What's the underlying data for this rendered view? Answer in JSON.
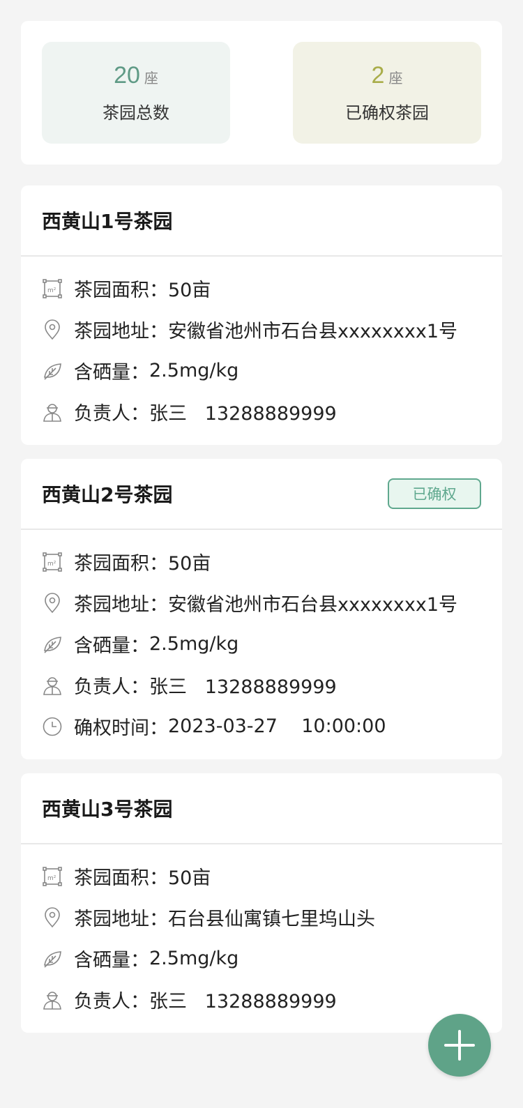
{
  "summary": {
    "total": {
      "value": "20",
      "unit": "座",
      "label": "茶园总数"
    },
    "confirmed": {
      "value": "2",
      "unit": "座",
      "label": "已确权茶园"
    }
  },
  "gardens": [
    {
      "name": "西黄山1号茶园",
      "badge": "",
      "area_label": "茶园面积：",
      "area": "50亩",
      "address_label": "茶园地址：",
      "address": "安徽省池州市石台县xxxxxxxx1号",
      "selenium_label": "含硒量：",
      "selenium": "2.5mg/kg",
      "owner_label": "负责人：",
      "owner": "张三   13288889999"
    },
    {
      "name": "西黄山2号茶园",
      "badge": "已确权",
      "area_label": "茶园面积：",
      "area": "50亩",
      "address_label": "茶园地址：",
      "address": "安徽省池州市石台县xxxxxxxx1号",
      "selenium_label": "含硒量：",
      "selenium": "2.5mg/kg",
      "owner_label": "负责人：",
      "owner": "张三   13288889999",
      "time_label": "确权时间：",
      "time": "2023-03-27    10:00:00"
    },
    {
      "name": "西黄山3号茶园",
      "badge": "",
      "area_label": "茶园面积：",
      "area": "50亩",
      "address_label": "茶园地址：",
      "address": "石台县仙寓镇七里坞山头",
      "selenium_label": "含硒量：",
      "selenium": "2.5mg/kg",
      "owner_label": "负责人：",
      "owner": "张三   13288889999"
    }
  ],
  "icons": {
    "area": "area-square-meter-icon",
    "address": "location-pin-icon",
    "selenium": "leaf-icon",
    "owner": "person-icon",
    "time": "clock-icon",
    "add": "plus-icon"
  },
  "colors": {
    "accent": "#5fa388",
    "total_num": "#5f9a86",
    "confirmed_num": "#a9ad4a",
    "badge_border": "#5fa88e",
    "badge_bg": "#e8f6ef"
  }
}
